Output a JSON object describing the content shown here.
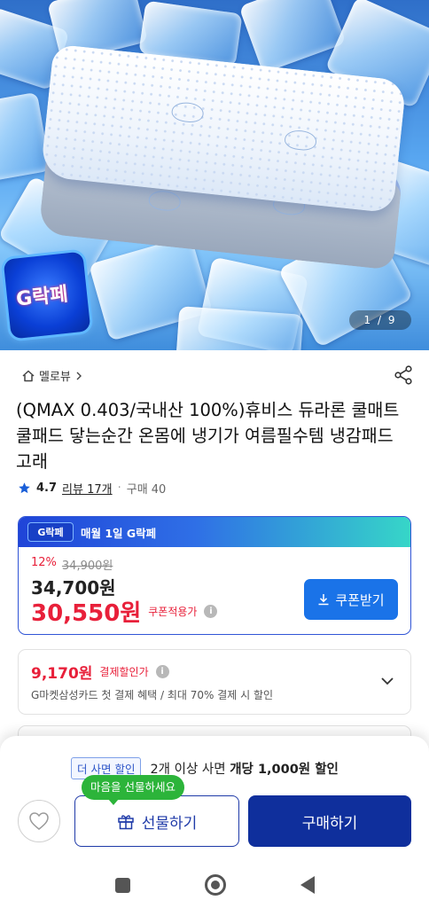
{
  "hero": {
    "counter": "1 / 9",
    "logo_text": "G락페"
  },
  "product": {
    "breadcrumb": "멜로뷰",
    "title": "(QMAX 0.403/국내산 100%)휴비스 듀라론 쿨매트 쿨패드 닿는순간 온몸에 냉기가 여름필수템 냉감패드 고래",
    "rating": "4.7",
    "review": "리뷰 17개",
    "separator": "·",
    "purchases": "구매 40"
  },
  "price_card": {
    "badge": "G락페",
    "event": "매월 1일 G락페",
    "discount_pct": "12%",
    "original_price": "34,900원",
    "sale_price": "34,700원",
    "coupon_price": "30,550원",
    "coupon_note": "쿠폰적용가",
    "coupon_button": "쿠폰받기"
  },
  "payment": {
    "amount": "9,170원",
    "label": "결제할인가",
    "description": "G마켓삼성카드 첫 결제 혜택 / 최대 70% 결제 시 할인"
  },
  "bottom_sheet": {
    "promo_tag": "더 사면 할인",
    "promo_prefix": "2개 이상 사면 ",
    "promo_bold": "개당 1,000원 할인",
    "gift_tooltip": "마음을 선물하세요",
    "gift_button": "선물하기",
    "buy_button": "구매하기"
  },
  "colors": {
    "accent_blue": "#1a73e8",
    "sale_red": "#e8203a",
    "buy_navy": "#0f2f9c",
    "tooltip_green": "#2cb43a"
  }
}
